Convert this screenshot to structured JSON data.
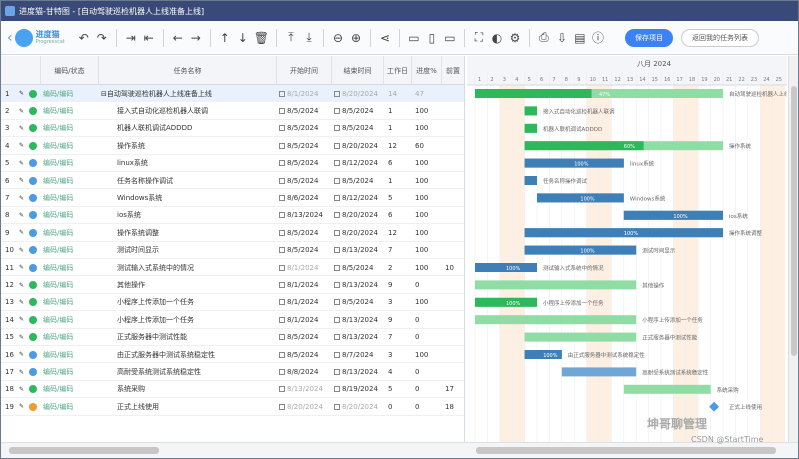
{
  "window": {
    "title": "进度猫-甘特图 - [自动驾驶巡检机器人上线准备上线]"
  },
  "toolbar": {
    "logo_name": "进度猫",
    "logo_sub": "Progresscat",
    "icons": [
      "undo-icon",
      "redo-icon",
      "indent-icon",
      "outdent-icon",
      "link-left-icon",
      "link-right-icon",
      "move-up-icon",
      "move-down-icon",
      "delete-icon",
      "expand-icon",
      "collapse-icon",
      "zoom-out-icon",
      "zoom-in-icon",
      "critical-path-icon",
      "layout-1-icon",
      "layout-2-icon",
      "layout-3-icon",
      "fullscreen-icon",
      "color-icon",
      "settings-icon",
      "print-icon",
      "export-icon",
      "import-icon",
      "help-icon"
    ],
    "save_label": "保存项目",
    "list_label": "返回我的任务列表"
  },
  "grid": {
    "headers": {
      "status": "编码/状态",
      "name": "任务名称",
      "start": "开始时间",
      "end": "结束时间",
      "duration": "工作日",
      "progress": "进度%",
      "extra": "前置"
    },
    "rows": [
      {
        "no": "1",
        "status": "编码/编码",
        "dot": "g",
        "name": "自动驾驶巡检机器人上线准备上线",
        "start": "8/1/2024",
        "end": "8/20/2024",
        "duration": "14",
        "progress": "47",
        "extra": "",
        "group": true,
        "grey": true
      },
      {
        "no": "2",
        "status": "编码/编码",
        "dot": "g",
        "name": "接入式自动化巡检机器人联调",
        "start": "8/5/2024",
        "end": "8/5/2024",
        "duration": "1",
        "progress": "100",
        "extra": ""
      },
      {
        "no": "3",
        "status": "编码/编码",
        "dot": "g",
        "name": "机器人联机调试ADDDD",
        "start": "8/5/2024",
        "end": "8/5/2024",
        "duration": "1",
        "progress": "100",
        "extra": ""
      },
      {
        "no": "4",
        "status": "编码/编码",
        "dot": "g",
        "name": "操作系统",
        "start": "8/5/2024",
        "end": "8/20/2024",
        "duration": "12",
        "progress": "60",
        "extra": ""
      },
      {
        "no": "5",
        "status": "编码/编码",
        "dot": "b",
        "name": "linux系统",
        "start": "8/5/2024",
        "end": "8/12/2024",
        "duration": "6",
        "progress": "100",
        "extra": ""
      },
      {
        "no": "6",
        "status": "编码/编码",
        "dot": "b",
        "name": "任务名称操作调试",
        "start": "8/5/2024",
        "end": "8/5/2024",
        "duration": "1",
        "progress": "100",
        "extra": ""
      },
      {
        "no": "7",
        "status": "编码/编码",
        "dot": "b",
        "name": "Windows系统",
        "start": "8/6/2024",
        "end": "8/12/2024",
        "duration": "5",
        "progress": "100",
        "extra": ""
      },
      {
        "no": "8",
        "status": "编码/编码",
        "dot": "b",
        "name": "ios系统",
        "start": "8/13/2024",
        "end": "8/20/2024",
        "duration": "6",
        "progress": "100",
        "extra": ""
      },
      {
        "no": "9",
        "status": "编码/编码",
        "dot": "b",
        "name": "操作系统调整",
        "start": "8/5/2024",
        "end": "8/20/2024",
        "duration": "12",
        "progress": "100",
        "extra": ""
      },
      {
        "no": "10",
        "status": "编码/编码",
        "dot": "b",
        "name": "测试时间显示",
        "start": "8/5/2024",
        "end": "8/13/2024",
        "duration": "7",
        "progress": "100",
        "extra": ""
      },
      {
        "no": "11",
        "status": "编码/编码",
        "dot": "b",
        "name": "测试输入式系统中的情况",
        "start": "8/1/2024",
        "end": "8/5/2024",
        "duration": "2",
        "progress": "100",
        "extra": "10",
        "grey_start": true
      },
      {
        "no": "12",
        "status": "编码/编码",
        "dot": "g",
        "name": "其他操作",
        "start": "8/1/2024",
        "end": "8/13/2024",
        "duration": "9",
        "progress": "0",
        "extra": ""
      },
      {
        "no": "13",
        "status": "编码/编码",
        "dot": "g",
        "name": "小程序上传添加一个任务",
        "start": "8/1/2024",
        "end": "8/5/2024",
        "duration": "3",
        "progress": "100",
        "extra": ""
      },
      {
        "no": "14",
        "status": "编码/编码",
        "dot": "g",
        "name": "小程序上传添加一个任务",
        "start": "8/1/2024",
        "end": "8/13/2024",
        "duration": "9",
        "progress": "0",
        "extra": ""
      },
      {
        "no": "15",
        "status": "编码/编码",
        "dot": "g",
        "name": "正式服务器中测试性能",
        "start": "8/5/2024",
        "end": "8/13/2024",
        "duration": "7",
        "progress": "0",
        "extra": ""
      },
      {
        "no": "16",
        "status": "编码/编码",
        "dot": "b",
        "name": "由正式服务器中测试系统稳定性",
        "start": "8/5/2024",
        "end": "8/7/2024",
        "duration": "3",
        "progress": "100",
        "extra": ""
      },
      {
        "no": "17",
        "status": "编码/编码",
        "dot": "b",
        "name": "高耐受系统测试系统稳定性",
        "start": "8/8/2024",
        "end": "8/13/2024",
        "duration": "4",
        "progress": "0",
        "extra": ""
      },
      {
        "no": "18",
        "status": "编码/编码",
        "dot": "g",
        "name": "系统采购",
        "start": "8/13/2024",
        "end": "8/19/2024",
        "duration": "5",
        "progress": "0",
        "extra": "17",
        "grey_start": true
      },
      {
        "no": "19",
        "status": "编码/编码",
        "dot": "o",
        "name": "正式上线使用",
        "start": "8/20/2024",
        "end": "8/20/2024",
        "duration": "0",
        "progress": "0",
        "extra": "18",
        "grey_start": true,
        "grey_end": true
      }
    ]
  },
  "gantt": {
    "month_label": "八月 2024",
    "day_labels": [
      "1",
      "2",
      "3",
      "4",
      "5",
      "6",
      "7",
      "8",
      "9",
      "10",
      "11",
      "12",
      "13",
      "14",
      "15",
      "16",
      "17",
      "18",
      "19",
      "20",
      "21",
      "22",
      "23",
      "24",
      "25"
    ],
    "bar_labels": [
      {
        "label": "47%",
        "right": "自动驾驶巡检机器人上线准备上线"
      },
      {
        "label": "",
        "right": "接入式自动化巡检机器人联调"
      },
      {
        "label": "",
        "right": "机器人联机调试ADDDD"
      },
      {
        "label": "60%",
        "right": "操作系统"
      },
      {
        "label": "100%",
        "right": "linux系统"
      },
      {
        "label": "",
        "right": "任务名称操作调试"
      },
      {
        "label": "100%",
        "right": "Windows系统"
      },
      {
        "label": "100%",
        "right": "ios系统"
      },
      {
        "label": "100%",
        "right": "操作系统调整"
      },
      {
        "label": "100%",
        "right": "测试时间显示"
      },
      {
        "label": "100%",
        "right": "测试输入式系统中的情况"
      },
      {
        "label": "",
        "right": "其他操作"
      },
      {
        "label": "100%",
        "right": "小程序上传添加一个任务"
      },
      {
        "label": "",
        "right": "小程序上传添加一个任务"
      },
      {
        "label": "",
        "right": "正式服务器中测试性能"
      },
      {
        "label": "100%",
        "right": "由正式服务器中测试系统稳定性"
      },
      {
        "label": "",
        "right": "高耐受系统测试系统稳定性"
      },
      {
        "label": "",
        "right": "系统采购"
      },
      {
        "label": "",
        "right": "正式上线使用"
      }
    ]
  },
  "watermark": {
    "main": "坤哥聊管理",
    "sub": "CSDN @StartTime"
  },
  "colors": {
    "green": "#2eb85c",
    "blue": "#3f7fb8",
    "weekend": "#fbe3cc"
  }
}
